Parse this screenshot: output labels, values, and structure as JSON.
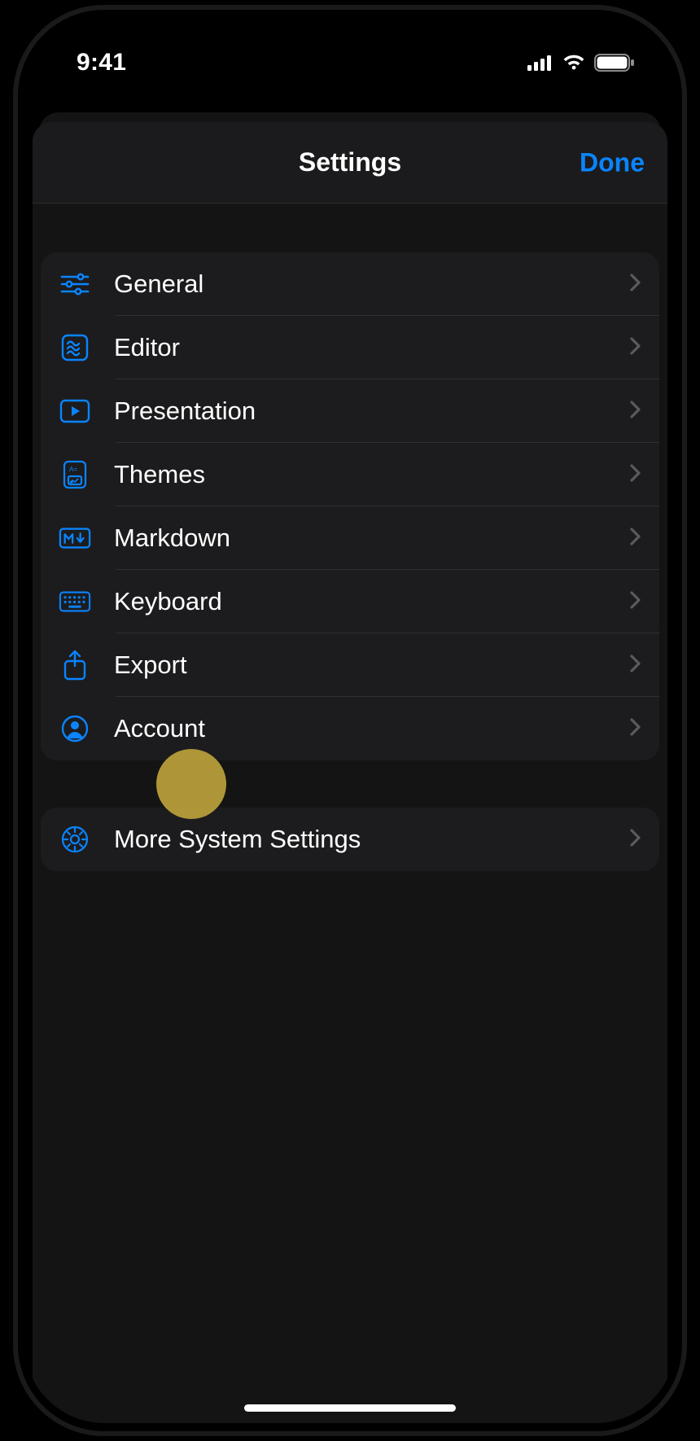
{
  "status": {
    "time": "9:41"
  },
  "nav": {
    "title": "Settings",
    "done": "Done"
  },
  "group1": {
    "items": [
      {
        "label": "General"
      },
      {
        "label": "Editor"
      },
      {
        "label": "Presentation"
      },
      {
        "label": "Themes"
      },
      {
        "label": "Markdown"
      },
      {
        "label": "Keyboard"
      },
      {
        "label": "Export"
      },
      {
        "label": "Account"
      }
    ]
  },
  "group2": {
    "items": [
      {
        "label": "More System Settings"
      }
    ]
  },
  "accent": "#0a84ff"
}
